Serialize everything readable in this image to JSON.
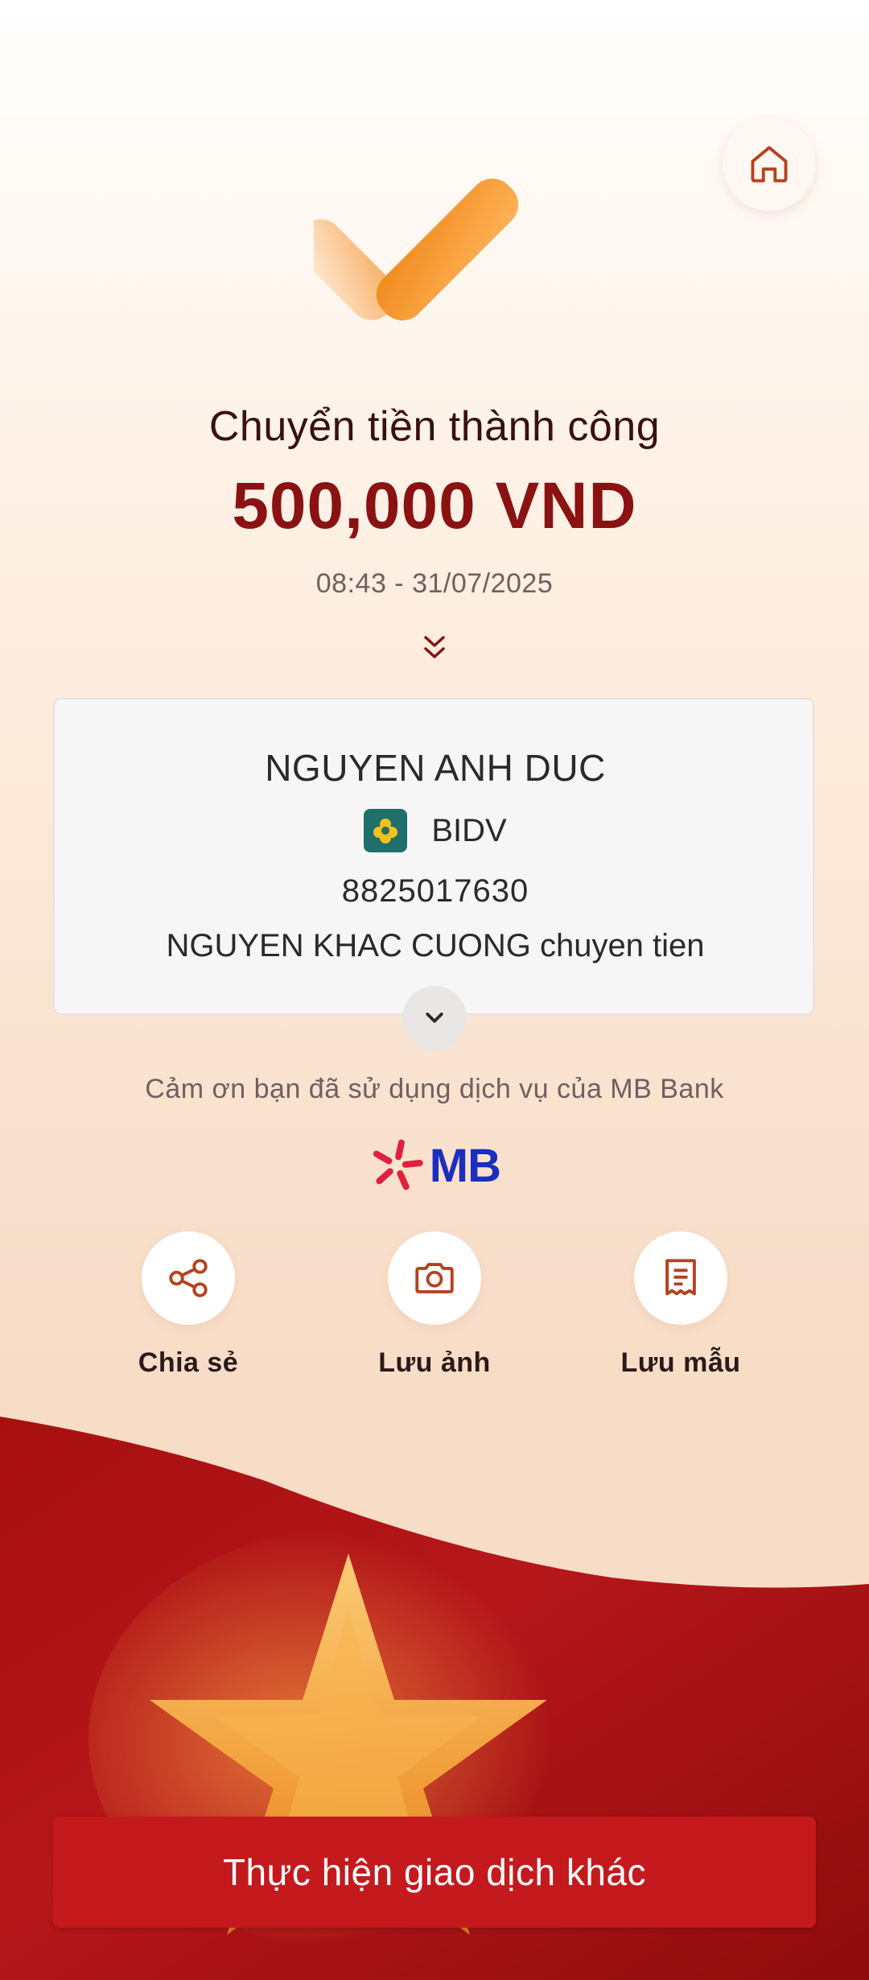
{
  "result": {
    "title": "Chuyển tiền thành công",
    "amount": "500,000 VND",
    "datetime": "08:43 - 31/07/2025"
  },
  "recipient": {
    "name": "NGUYEN ANH DUC",
    "bank": "BIDV",
    "account": "8825017630",
    "memo": "NGUYEN KHAC CUONG chuyen tien"
  },
  "footer": {
    "thanks": "Cảm ơn bạn đã sử dụng dịch vụ của MB Bank",
    "brand": "MB"
  },
  "actions": [
    {
      "label": "Chia sẻ",
      "icon": "share-icon"
    },
    {
      "label": "Lưu ảnh",
      "icon": "camera-icon"
    },
    {
      "label": "Lưu mẫu",
      "icon": "receipt-icon"
    }
  ],
  "primary_button": {
    "label": "Thực hiện giao dịch khác"
  },
  "colors": {
    "brand_red": "#c41a1d",
    "amount_red": "#8a1212",
    "accent_orange": "#f39a2b",
    "mb_blue": "#1a2fbf"
  }
}
